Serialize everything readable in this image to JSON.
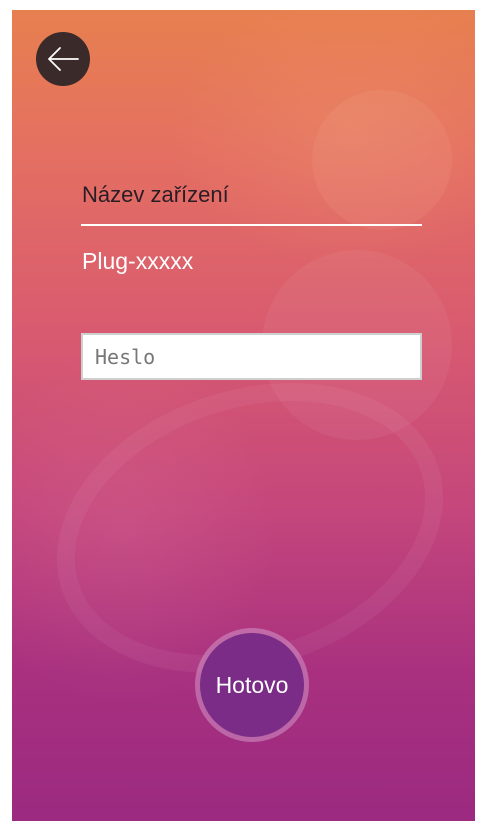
{
  "header": {
    "back_icon": "arrow-left-icon"
  },
  "form": {
    "device_label": "Název zařízení",
    "device_name": "Plug-xxxxx",
    "password_placeholder": "Heslo",
    "password_value": ""
  },
  "actions": {
    "done_label": "Hotovo"
  },
  "colors": {
    "gradient_top": "#e7804f",
    "gradient_bottom": "#9b2a80",
    "back_button": "#3a2a2a",
    "done_button": "#7a2c86"
  }
}
